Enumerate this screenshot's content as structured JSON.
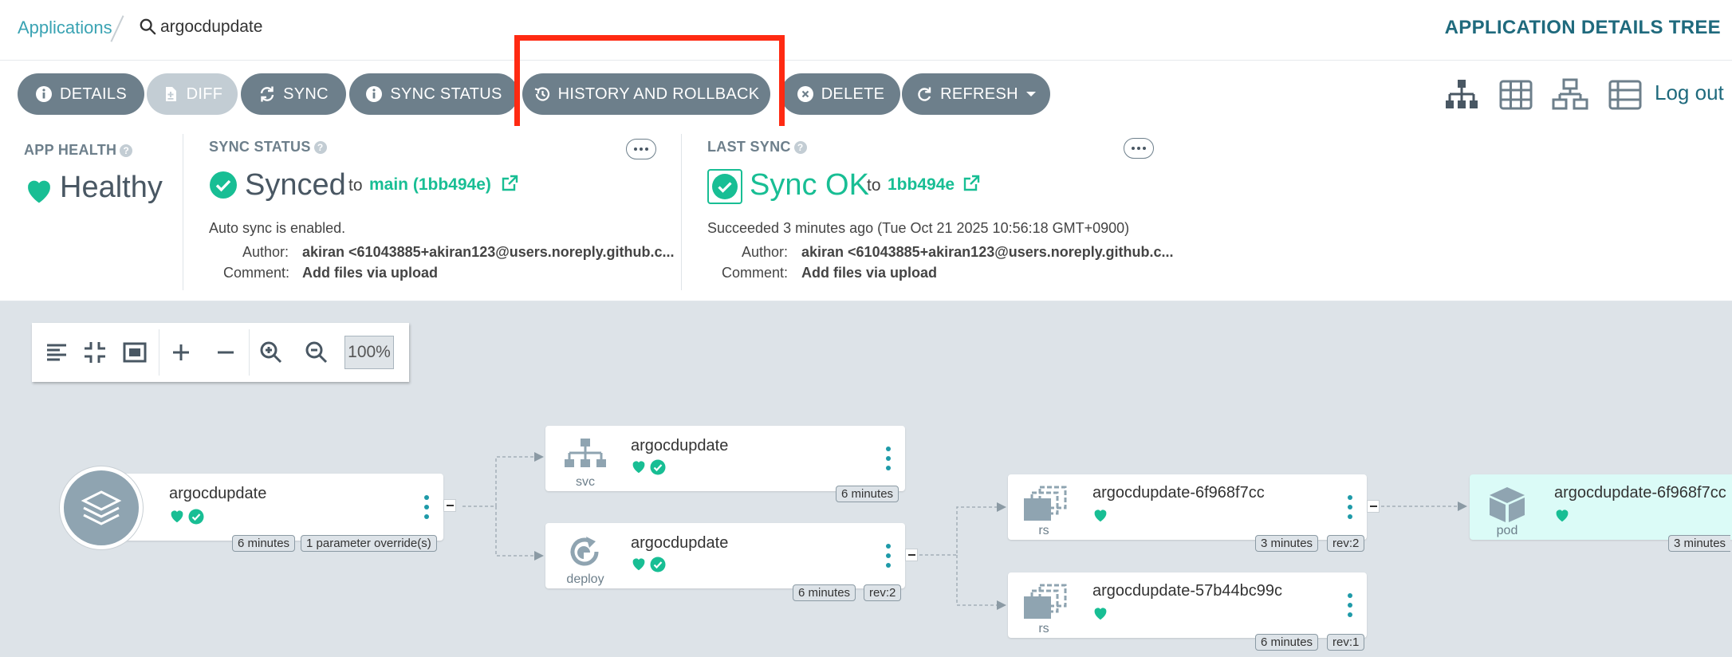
{
  "breadcrumb": {
    "root": "Applications",
    "current": "argocdupdate"
  },
  "page_title": "APPLICATION DETAILS TREE",
  "actions": [
    {
      "label": "DETAILS",
      "icon": "info-icon"
    },
    {
      "label": "DIFF",
      "icon": "file-diff-icon",
      "disabled": true
    },
    {
      "label": "SYNC",
      "icon": "sync-icon"
    },
    {
      "label": "SYNC STATUS",
      "icon": "info-icon"
    },
    {
      "label": "HISTORY AND ROLLBACK",
      "icon": "history-icon"
    },
    {
      "label": "DELETE",
      "icon": "delete-circle-icon"
    },
    {
      "label": "REFRESH",
      "icon": "refresh-icon"
    }
  ],
  "view_modes": [
    "tree-view-icon",
    "pods-grid-icon",
    "network-view-icon",
    "list-view-icon"
  ],
  "logout": "Log out",
  "app_health": {
    "label": "APP HEALTH",
    "value": "Healthy"
  },
  "sync_status": {
    "label": "SYNC STATUS",
    "value": "Synced",
    "to": "to",
    "revision": "main (1bb494e)",
    "auto_sync": "Auto sync is enabled.",
    "author_label": "Author:",
    "author": "akiran <61043885+akiran123@users.noreply.github.c...",
    "comment_label": "Comment:",
    "comment": "Add files via upload"
  },
  "last_sync": {
    "label": "LAST SYNC",
    "value": "Sync OK",
    "to": "to",
    "revision": "1bb494e",
    "succeeded": "Succeeded 3 minutes ago (Tue Oct 21 2025 10:56:18 GMT+0900)",
    "author_label": "Author:",
    "author": "akiran <61043885+akiran123@users.noreply.github.c...",
    "comment_label": "Comment:",
    "comment": "Add files via upload"
  },
  "zoom": "100%",
  "nodes": {
    "app": {
      "title": "argocdupdate",
      "age": "6 minutes",
      "extra": "1 parameter override(s)"
    },
    "svc": {
      "title": "argocdupdate",
      "kind": "svc",
      "age": "6 minutes"
    },
    "deploy": {
      "title": "argocdupdate",
      "kind": "deploy",
      "age": "6 minutes",
      "rev": "rev:2"
    },
    "rs1": {
      "title": "argocdupdate-6f968f7cc",
      "kind": "rs",
      "age": "3 minutes",
      "rev": "rev:2"
    },
    "rs2": {
      "title": "argocdupdate-57b44bc99c",
      "kind": "rs",
      "age": "6 minutes",
      "rev": "rev:1"
    },
    "pod": {
      "title": "argocdupdate-6f968f7cc",
      "kind": "pod",
      "age": "3 minutes"
    }
  },
  "colors": {
    "accent": "#18be94",
    "teal": "#1e9aa8",
    "button": "#6d7f8b",
    "highlight": "#ff2a12"
  }
}
